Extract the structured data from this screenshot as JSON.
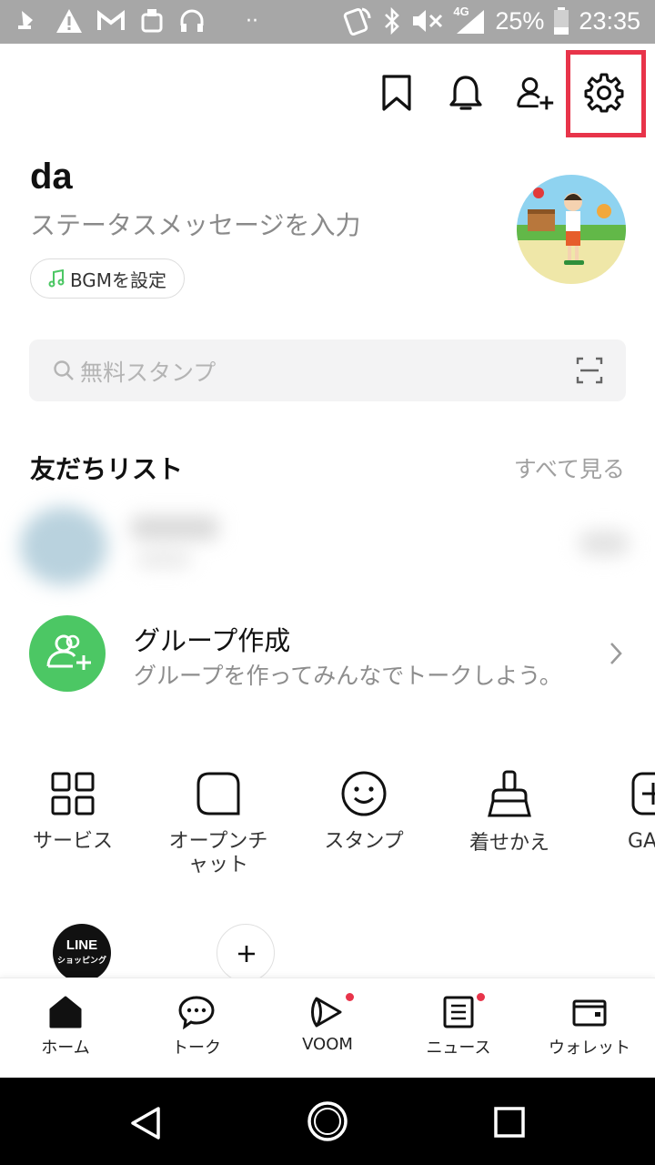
{
  "status_bar": {
    "battery": "25%",
    "time": "23:35",
    "network": "4G"
  },
  "top_bar": {
    "icons": [
      "bookmark-icon",
      "bell-icon",
      "add-friend-icon",
      "settings-icon"
    ]
  },
  "profile": {
    "name": "da",
    "status_placeholder": "ステータスメッセージを入力",
    "bgm_label": "BGMを設定"
  },
  "search": {
    "placeholder": "無料スタンプ"
  },
  "friends": {
    "title": "友だちリスト",
    "see_all": "すべて見る"
  },
  "group": {
    "title": "グループ作成",
    "description": "グループを作ってみんなでトークしよう。"
  },
  "services": [
    {
      "label": "サービス",
      "icon": "grid-icon"
    },
    {
      "label": "オープンチャット",
      "icon": "open-chat-icon"
    },
    {
      "label": "スタンプ",
      "icon": "smile-icon"
    },
    {
      "label": "着せかえ",
      "icon": "brush-icon"
    },
    {
      "label": "GA",
      "icon": "plus-square-icon"
    }
  ],
  "shortcuts": {
    "line_shopping": {
      "line1": "LINE",
      "line2": "ショッピング"
    }
  },
  "bottom_nav": [
    {
      "label": "ホーム",
      "icon": "home-icon"
    },
    {
      "label": "トーク",
      "icon": "chat-icon"
    },
    {
      "label": "VOOM",
      "icon": "voom-icon"
    },
    {
      "label": "ニュース",
      "icon": "news-icon"
    },
    {
      "label": "ウォレット",
      "icon": "wallet-icon"
    }
  ],
  "colors": {
    "accent_green": "#4cc764",
    "highlight_red": "#e8344a",
    "status_bar": "#a7a7a7"
  }
}
